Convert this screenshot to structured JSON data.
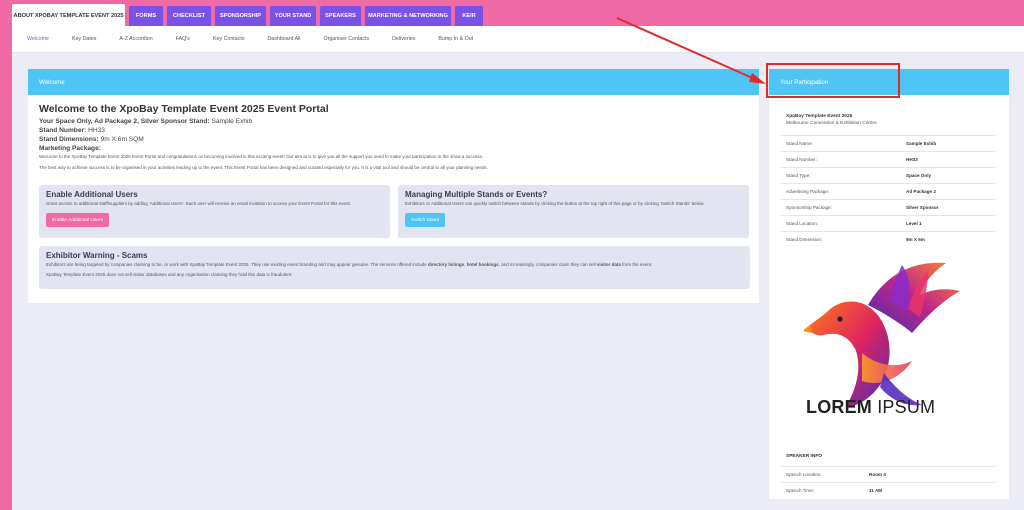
{
  "topnav": {
    "tabs": [
      {
        "label": "ABOUT XPOBAY TEMPLATE EVENT 2025",
        "w": 113
      },
      {
        "label": "FORMS",
        "w": 34
      },
      {
        "label": "CHECKLIST",
        "w": 44
      },
      {
        "label": "SPONSORSHIP",
        "w": 51
      },
      {
        "label": "YOUR STAND",
        "w": 46
      },
      {
        "label": "SPEAKERS",
        "w": 41
      },
      {
        "label": "MARKETING & NETWORKING",
        "w": 86
      },
      {
        "label": "KEIR",
        "w": 28
      }
    ]
  },
  "subnav": [
    "Welcome",
    "Key Dates",
    "A-Z Accordion",
    "FAQ's",
    "Key Contacts",
    "Dashboard All",
    "Organiser Contacts",
    "Deliveries",
    "Bump In & Out"
  ],
  "welcome": {
    "header": "Welcome",
    "title": "Welcome to the XpoBay Template Event 2025 Event Portal",
    "space_line": "Your Space Only, Ad Package 2, Silver Sponsor Stand:",
    "space_value": "Sample Exhib",
    "stand_number_label": "Stand Number:",
    "stand_number_value": "HH33",
    "stand_dim_label": "Stand Dimensions:",
    "stand_dim_value": "9m X 6m SQM",
    "marketing_label": "Marketing Package:",
    "intro": "Welcome to the XpoBay Template Event 2025 Event Portal and congratulations on becoming involved in this exciting event! Our aim at is to give you all the support you need to make your participation in the show a success.",
    "intro2": "The best way to achieve success is to be organised in your activities leading up to the event. This Event Portal has been designed and curated especially for you. It is a vital tool and should be central to all your planning needs."
  },
  "users_box": {
    "title": "Enable Additional Users",
    "text": "Grant access to additional staff/suppliers by adding 'Additional Users'. Each user will receive an email invitation to access your Event Portal for this event.",
    "button": "Enable Additional Users"
  },
  "stands_box": {
    "title": "Managing Multiple Stands or Events?",
    "text": "Exhibitors or Additional Users can quickly switch between stands by clicking the button at the top right of this page or by clicking 'Switch Stands' below.",
    "button": "Switch Stand"
  },
  "warning": {
    "title": "Exhibitor Warning - Scams",
    "t1": "Exhibitors are being targeted by companies claiming to be, or work with XpoBay Template Event 2025. They use existing event branding and may appear genuine. The services offered include ",
    "b1": "directory listings",
    "t2": ", ",
    "b2": "hotel bookings",
    "t3": ", and increasingly, companies claim they can sell ",
    "b3": "visitor data",
    "t4": " from the event.",
    "text2": "XpoBay Template Event 2025 does not sell visitor databases and any organisation claiming they hold this data is fraudulent."
  },
  "participation": {
    "header": "Your Participation",
    "event": "XpoBay Template Event 2025",
    "venue": "Melbourne Convention & Exhibition Centre",
    "rows": [
      {
        "k": "Stand Name:",
        "v": "Sample Exhib"
      },
      {
        "k": "Stand Number:",
        "v": "HH33"
      },
      {
        "k": "Stand Type:",
        "v": "Space Only"
      },
      {
        "k": "Advertising Package:",
        "v": "Ad Package 2"
      },
      {
        "k": "Sponsorship Package:",
        "v": "Silver Sponsor"
      },
      {
        "k": "Stand Location:",
        "v": "Level 1"
      },
      {
        "k": "Stand Dimension:",
        "v": "9m X 6m"
      }
    ],
    "logo_bold": "LOREM",
    "logo_light": "IPSUM",
    "speaker_header": "SPEAKER INFO",
    "speaker_rows": [
      {
        "k": "Speech Location:",
        "v": "Room 4"
      },
      {
        "k": "Speech Time:",
        "v": "11 AM"
      }
    ]
  },
  "colors": {
    "tab": "#7a52e6",
    "header": "#4fc5f6",
    "pink_button": "#f06aa6",
    "cyan_button": "#4fc5f6",
    "frame": "#f06aa6",
    "annotation": "#e22a2a"
  }
}
